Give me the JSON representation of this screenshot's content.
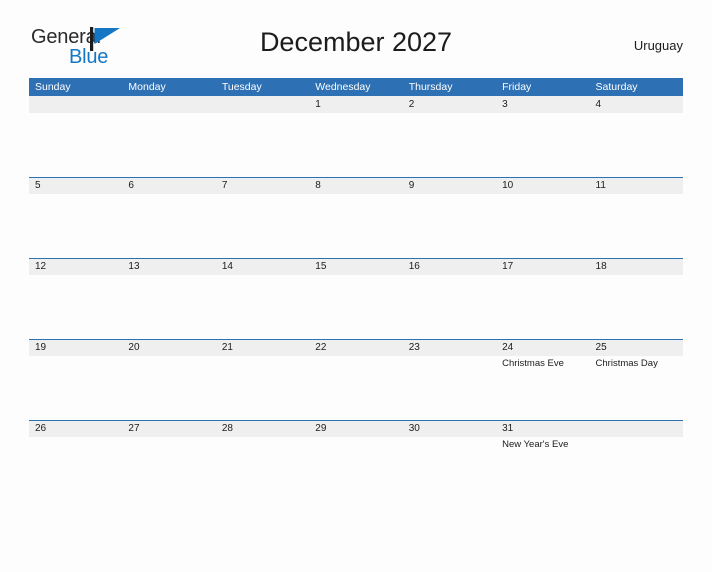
{
  "logo": {
    "text_primary": "General",
    "text_secondary": "Blue",
    "flag_icon": "flag-icon",
    "flag_color": "#1577c4",
    "pole_color": "#1c1c1c"
  },
  "header": {
    "title": "December 2027",
    "region": "Uruguay"
  },
  "colors": {
    "header_blue": "#2e70b4",
    "band_gray": "#efefef",
    "page_background": "#fdfdfd",
    "text": "#1c1c1c",
    "header_text": "#ffffff"
  },
  "weekdays": [
    "Sunday",
    "Monday",
    "Tuesday",
    "Wednesday",
    "Thursday",
    "Friday",
    "Saturday"
  ],
  "weeks": [
    [
      {
        "day": "",
        "event": ""
      },
      {
        "day": "",
        "event": ""
      },
      {
        "day": "",
        "event": ""
      },
      {
        "day": "1",
        "event": ""
      },
      {
        "day": "2",
        "event": ""
      },
      {
        "day": "3",
        "event": ""
      },
      {
        "day": "4",
        "event": ""
      }
    ],
    [
      {
        "day": "5",
        "event": ""
      },
      {
        "day": "6",
        "event": ""
      },
      {
        "day": "7",
        "event": ""
      },
      {
        "day": "8",
        "event": ""
      },
      {
        "day": "9",
        "event": ""
      },
      {
        "day": "10",
        "event": ""
      },
      {
        "day": "11",
        "event": ""
      }
    ],
    [
      {
        "day": "12",
        "event": ""
      },
      {
        "day": "13",
        "event": ""
      },
      {
        "day": "14",
        "event": ""
      },
      {
        "day": "15",
        "event": ""
      },
      {
        "day": "16",
        "event": ""
      },
      {
        "day": "17",
        "event": ""
      },
      {
        "day": "18",
        "event": ""
      }
    ],
    [
      {
        "day": "19",
        "event": ""
      },
      {
        "day": "20",
        "event": ""
      },
      {
        "day": "21",
        "event": ""
      },
      {
        "day": "22",
        "event": ""
      },
      {
        "day": "23",
        "event": ""
      },
      {
        "day": "24",
        "event": "Christmas Eve"
      },
      {
        "day": "25",
        "event": "Christmas Day"
      }
    ],
    [
      {
        "day": "26",
        "event": ""
      },
      {
        "day": "27",
        "event": ""
      },
      {
        "day": "28",
        "event": ""
      },
      {
        "day": "29",
        "event": ""
      },
      {
        "day": "30",
        "event": ""
      },
      {
        "day": "31",
        "event": "New Year's Eve"
      },
      {
        "day": "",
        "event": ""
      }
    ]
  ]
}
